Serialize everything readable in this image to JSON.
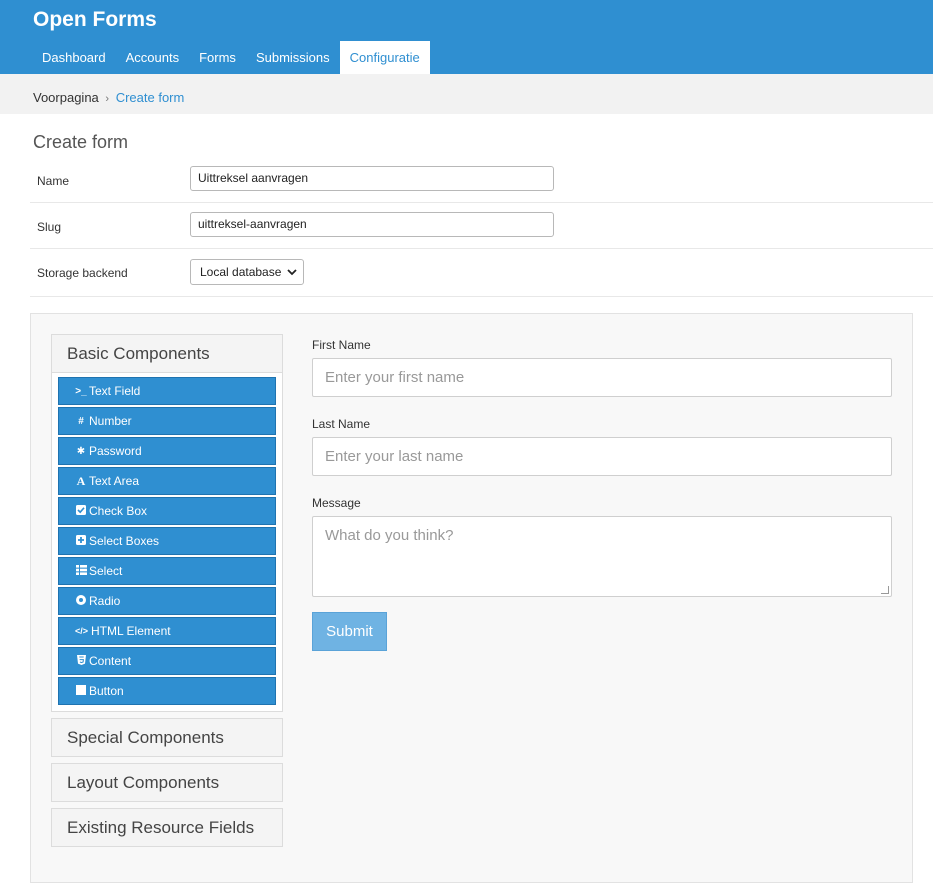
{
  "app": {
    "title": "Open Forms"
  },
  "nav": {
    "items": [
      "Dashboard",
      "Accounts",
      "Forms",
      "Submissions",
      "Configuratie"
    ],
    "active": "Configuratie"
  },
  "breadcrumb": {
    "root": "Voorpagina",
    "separator": "›",
    "current": "Create form"
  },
  "page": {
    "title": "Create form"
  },
  "form": {
    "name": {
      "label": "Name",
      "value": "Uittreksel aanvragen"
    },
    "slug": {
      "label": "Slug",
      "value": "uittreksel-aanvragen"
    },
    "storage": {
      "label": "Storage backend",
      "value": "Local database"
    }
  },
  "builder": {
    "groups": {
      "basic": {
        "title": "Basic Components",
        "items": [
          {
            "label": "Text Field",
            "icon": "terminal-icon"
          },
          {
            "label": "Number",
            "icon": "hashtag-icon"
          },
          {
            "label": "Password",
            "icon": "asterisk-icon"
          },
          {
            "label": "Text Area",
            "icon": "font-icon"
          },
          {
            "label": "Check Box",
            "icon": "check-square-icon"
          },
          {
            "label": "Select Boxes",
            "icon": "plus-square-icon"
          },
          {
            "label": "Select",
            "icon": "th-list-icon"
          },
          {
            "label": "Radio",
            "icon": "dot-circle-icon"
          },
          {
            "label": "HTML Element",
            "icon": "code-icon"
          },
          {
            "label": "Content",
            "icon": "html5-icon"
          },
          {
            "label": "Button",
            "icon": "stop-icon"
          }
        ]
      },
      "special": {
        "title": "Special Components"
      },
      "layout": {
        "title": "Layout Components"
      },
      "existing": {
        "title": "Existing Resource Fields"
      }
    },
    "preview": {
      "first_name": {
        "label": "First Name",
        "placeholder": "Enter your first name"
      },
      "last_name": {
        "label": "Last Name",
        "placeholder": "Enter your last name"
      },
      "message": {
        "label": "Message",
        "placeholder": "What do you think?"
      },
      "submit_label": "Submit"
    }
  },
  "colors": {
    "brand": "#2f8fd1",
    "submit": "#6fb3e3"
  }
}
